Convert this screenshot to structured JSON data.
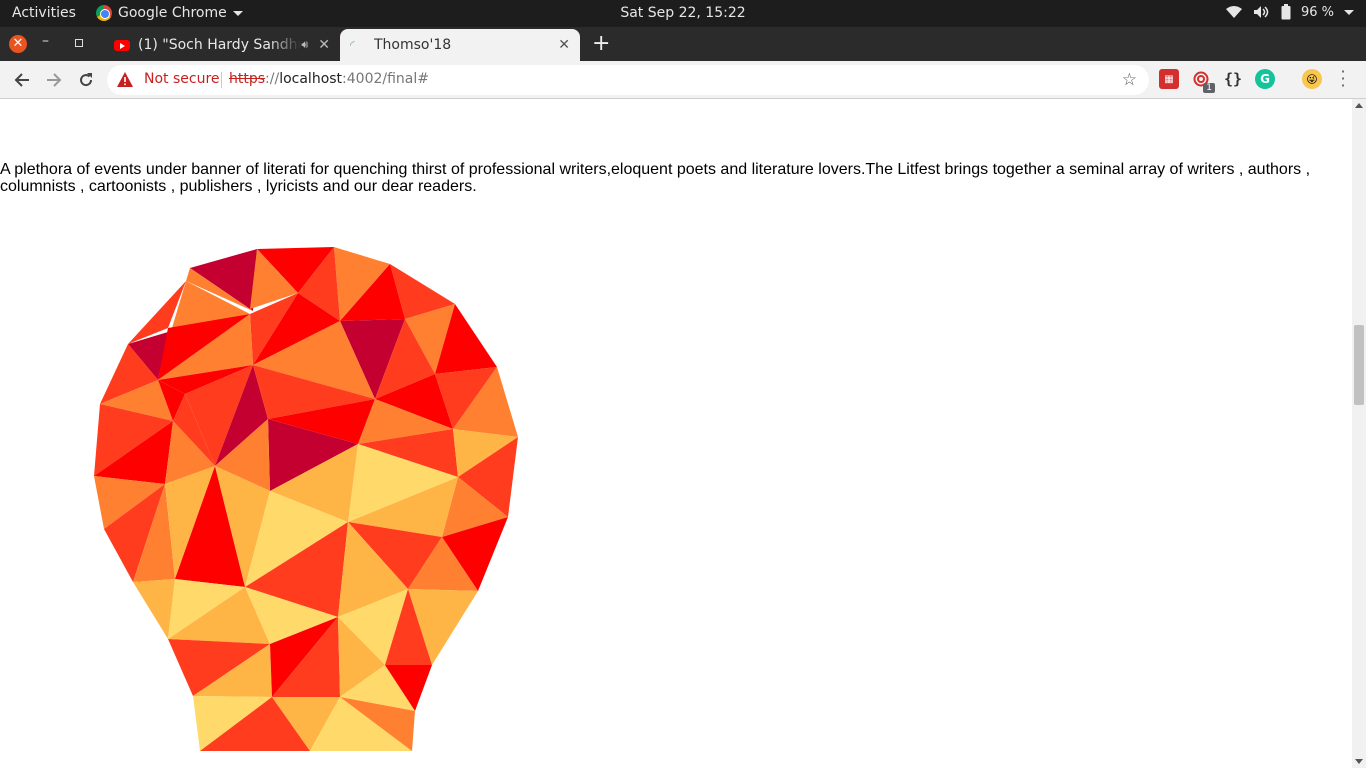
{
  "system_bar": {
    "activities": "Activities",
    "app_name": "Google Chrome",
    "clock": "Sat Sep 22, 15:22",
    "battery": "96 %"
  },
  "tabs": [
    {
      "title": "(1) \"Soch Hardy Sandhu",
      "active": false,
      "audio": true
    },
    {
      "title": "Thomso'18",
      "active": true,
      "audio": false
    }
  ],
  "address_bar": {
    "security_label": "Not secure",
    "url_scheme": "https",
    "url_sep": "://",
    "url_host": "localhost",
    "url_rest": ":4002/final#"
  },
  "extensions": {
    "badge_count": "1",
    "json_label": "{}",
    "grammarly_letter": "G"
  },
  "page": {
    "description": "A plethora of events under banner of literati for quenching thirst of professional writers,eloquent poets and literature lovers.The Litfest brings together a seminal array of writers , authors , columnists , cartoonists , publishers , lyricists and our dear readers."
  },
  "colors": {
    "deep_red": "#c3002f",
    "red": "#ff0000",
    "red_orange": "#ff3c1e",
    "orange": "#ff8030",
    "light_orange": "#ffb545",
    "yellow": "#ffda6a",
    "warning": "#c5221f"
  }
}
